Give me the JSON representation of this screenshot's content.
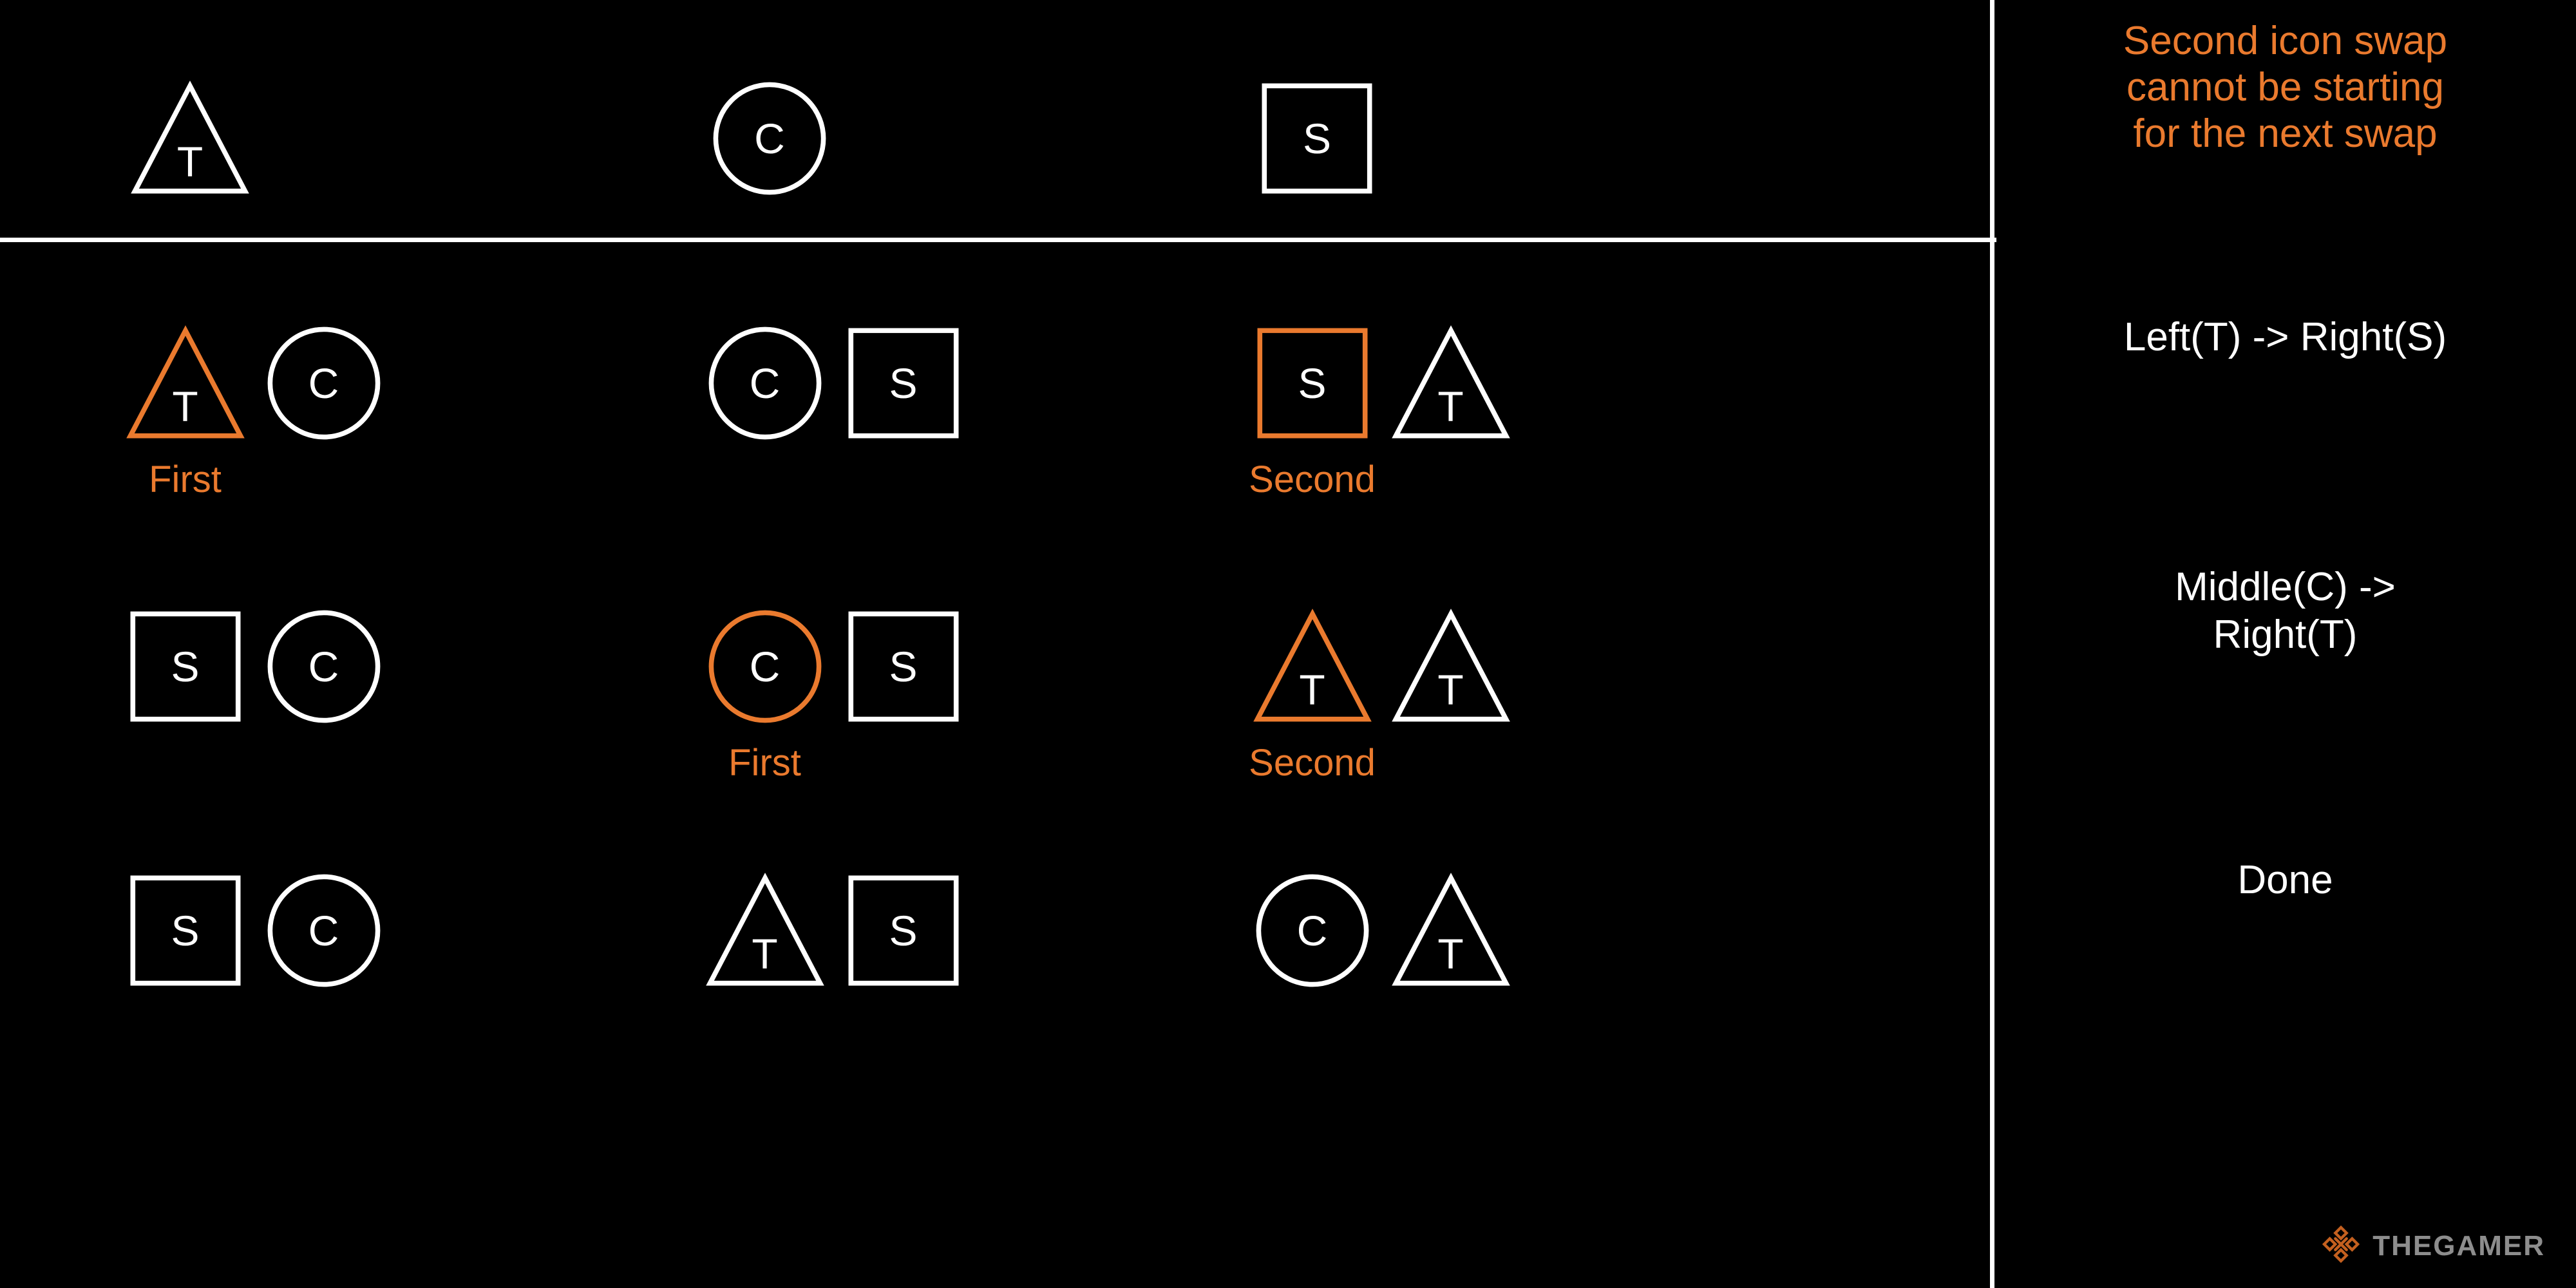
{
  "colors": {
    "background": "#000000",
    "stroke_default": "#ffffff",
    "stroke_highlight": "#ea7a2e",
    "text_default": "#ffffff",
    "text_highlight": "#ea7a2e",
    "watermark_text": "#8d8d8d",
    "watermark_mark": "#c4601f"
  },
  "header_row": {
    "icons": [
      {
        "shape": "triangle",
        "letter": "T",
        "state": "default"
      },
      {
        "shape": "circle",
        "letter": "C",
        "state": "default"
      },
      {
        "shape": "square",
        "letter": "S",
        "state": "default"
      }
    ]
  },
  "panel": {
    "note": "Second icon swap cannot be starting for the next swap",
    "note_lines": [
      "Second icon swap",
      "cannot be starting",
      "for the next swap"
    ],
    "steps": [
      {
        "text": "Left(T) -> Right(S)",
        "lines": [
          "Left(T) -> Right(S)"
        ]
      },
      {
        "text": "Middle(C) -> Right(T)",
        "lines": [
          "Middle(C) ->",
          "Right(T)"
        ]
      },
      {
        "text": "Done",
        "lines": [
          "Done"
        ]
      }
    ]
  },
  "rows": [
    {
      "step_index": 0,
      "cells": [
        {
          "position": "left",
          "icons": [
            {
              "shape": "triangle",
              "letter": "T",
              "state": "highlight",
              "label": "First"
            },
            {
              "shape": "circle",
              "letter": "C",
              "state": "default",
              "label": ""
            }
          ]
        },
        {
          "position": "middle",
          "icons": [
            {
              "shape": "circle",
              "letter": "C",
              "state": "default",
              "label": ""
            },
            {
              "shape": "square",
              "letter": "S",
              "state": "default",
              "label": ""
            }
          ]
        },
        {
          "position": "right",
          "icons": [
            {
              "shape": "square",
              "letter": "S",
              "state": "highlight",
              "label": "Second"
            },
            {
              "shape": "triangle",
              "letter": "T",
              "state": "default",
              "label": ""
            }
          ]
        }
      ]
    },
    {
      "step_index": 1,
      "cells": [
        {
          "position": "left",
          "icons": [
            {
              "shape": "square",
              "letter": "S",
              "state": "default",
              "label": ""
            },
            {
              "shape": "circle",
              "letter": "C",
              "state": "default",
              "label": ""
            }
          ]
        },
        {
          "position": "middle",
          "icons": [
            {
              "shape": "circle",
              "letter": "C",
              "state": "highlight",
              "label": "First"
            },
            {
              "shape": "square",
              "letter": "S",
              "state": "default",
              "label": ""
            }
          ]
        },
        {
          "position": "right",
          "icons": [
            {
              "shape": "triangle",
              "letter": "T",
              "state": "highlight",
              "label": "Second"
            },
            {
              "shape": "triangle",
              "letter": "T",
              "state": "default",
              "label": ""
            }
          ]
        }
      ]
    },
    {
      "step_index": 2,
      "cells": [
        {
          "position": "left",
          "icons": [
            {
              "shape": "square",
              "letter": "S",
              "state": "default",
              "label": ""
            },
            {
              "shape": "circle",
              "letter": "C",
              "state": "default",
              "label": ""
            }
          ]
        },
        {
          "position": "middle",
          "icons": [
            {
              "shape": "triangle",
              "letter": "T",
              "state": "default",
              "label": ""
            },
            {
              "shape": "square",
              "letter": "S",
              "state": "default",
              "label": ""
            }
          ]
        },
        {
          "position": "right",
          "icons": [
            {
              "shape": "circle",
              "letter": "C",
              "state": "default",
              "label": ""
            },
            {
              "shape": "triangle",
              "letter": "T",
              "state": "default",
              "label": ""
            }
          ]
        }
      ]
    }
  ],
  "watermark": {
    "text": "THEGAMER"
  }
}
